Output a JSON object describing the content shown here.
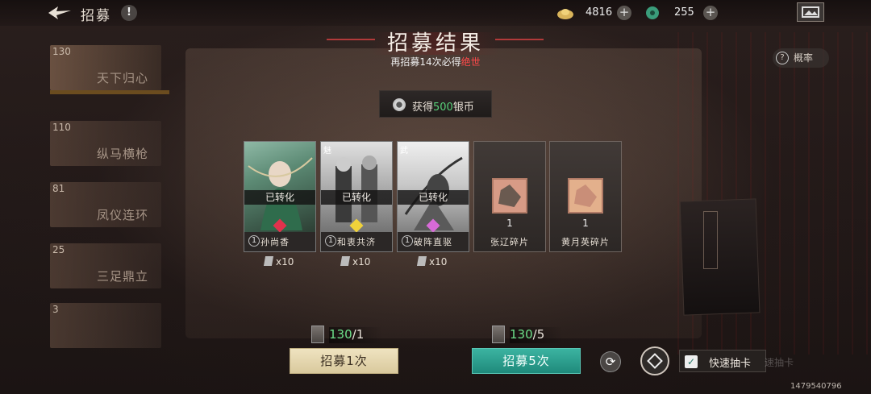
{
  "topbar": {
    "title": "招募",
    "info": "!",
    "currencies": [
      {
        "icon": "gold-ingot-icon",
        "value": "4816",
        "plus": "+"
      },
      {
        "icon": "jade-icon",
        "value": "255",
        "plus": "+"
      }
    ]
  },
  "pools": [
    {
      "count": "130",
      "name": "天下归心"
    },
    {
      "count": "110",
      "name": "纵马横枪"
    },
    {
      "count": "81",
      "name": "凤仪连环"
    },
    {
      "count": "25",
      "name": "三足鼎立"
    },
    {
      "count": "3",
      "name": ""
    }
  ],
  "header": {
    "title": "招募结果",
    "subtitle_prefix": "再招募14次必得",
    "subtitle_highlight": "绝世"
  },
  "probability": {
    "icon": "?",
    "label": "概率"
  },
  "reward": {
    "prefix": "获得",
    "amount": "500",
    "suffix": "银币"
  },
  "cards": [
    {
      "tag": "",
      "converted": "已转化",
      "num": "1",
      "name": "孙尚香",
      "count": "x10",
      "gem": "#e0324c"
    },
    {
      "tag": "魅",
      "converted": "已转化",
      "num": "1",
      "name": "和衷共济",
      "count": "x10",
      "gem": "#f0d23a"
    },
    {
      "tag": "武",
      "converted": "已转化",
      "num": "1",
      "name": "破阵直驱",
      "count": "x10",
      "gem": "#d86ad8"
    }
  ],
  "fragments": [
    {
      "qty": "1",
      "name": "张辽碎片"
    },
    {
      "qty": "1",
      "name": "黄月英碎片"
    }
  ],
  "draw": {
    "once": {
      "cost": "130",
      "den": "/1",
      "label": "招募1次"
    },
    "five": {
      "cost": "130",
      "den": "/5",
      "label": "招募5次"
    }
  },
  "controls": {
    "refresh": "⟳",
    "fast_draw_check": "✓",
    "fast_draw_label": "快速抽卡",
    "fast_draw_ghost": "速抽卡"
  },
  "uid": "1479540796",
  "colors": {
    "accent_red": "#ff4a4a",
    "green": "#58d07a",
    "teal_button": "#2a9d8c",
    "beige_button": "#e6d8b0"
  }
}
